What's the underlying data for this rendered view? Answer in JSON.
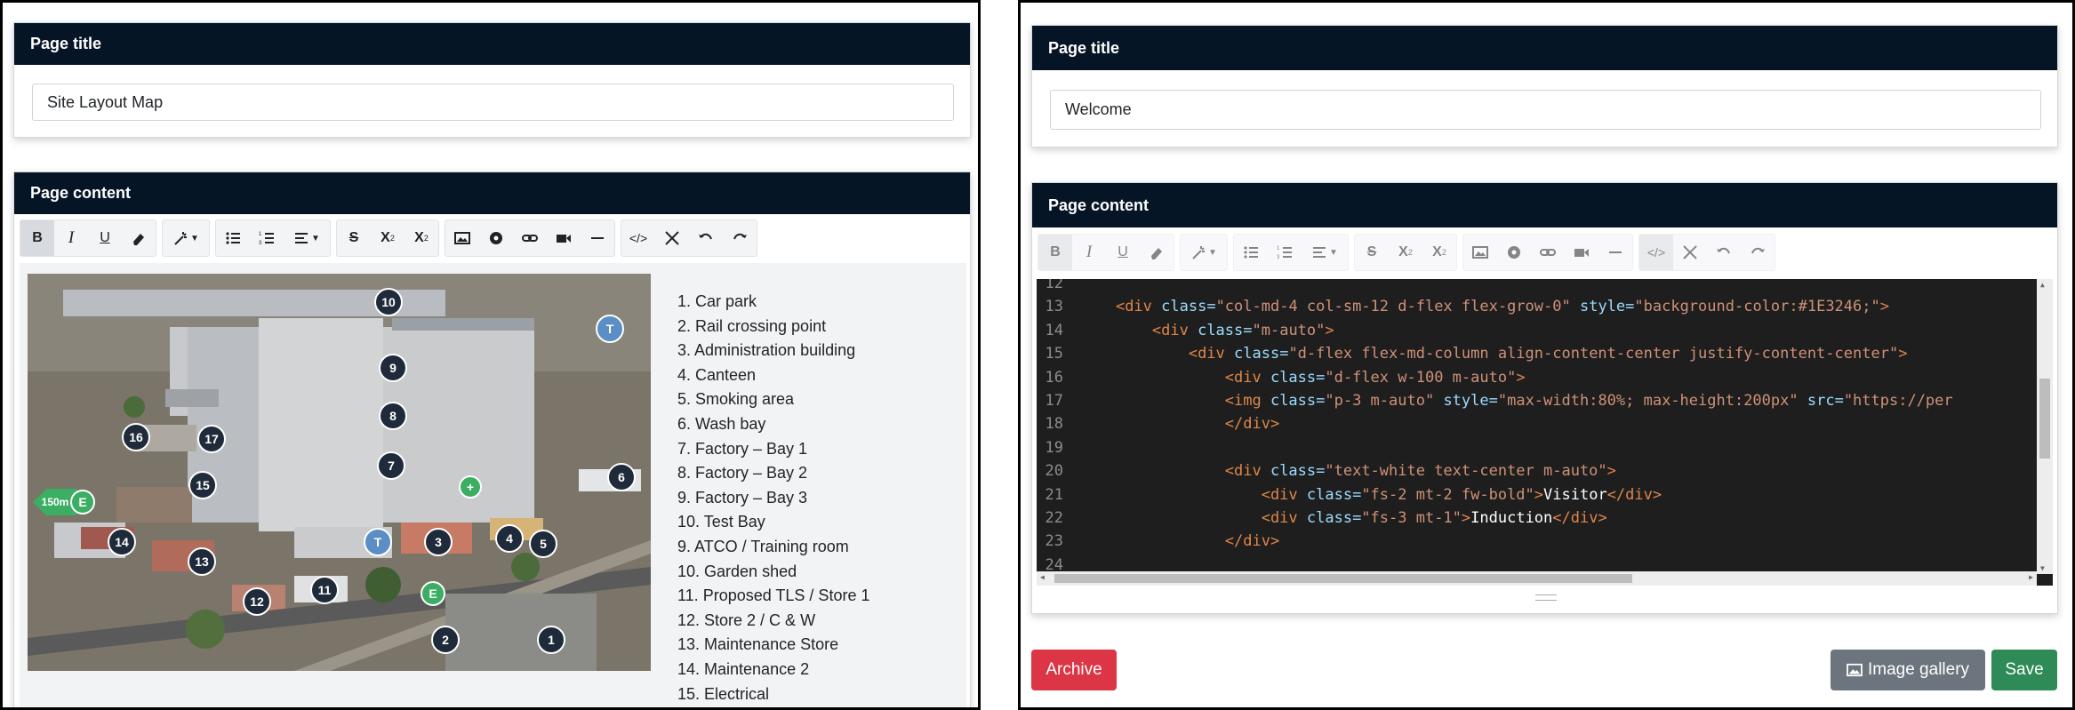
{
  "left_panel": {
    "title_card": {
      "header": "Page title",
      "value": "Site Layout Map"
    },
    "content_card": {
      "header": "Page content",
      "map": {
        "distance_badge": "150m",
        "exit_label": "E"
      },
      "legend": [
        "1. Car park",
        "2. Rail crossing point",
        "3. Administration building",
        "4. Canteen",
        "5. Smoking area",
        "6. Wash bay",
        "7. Factory – Bay 1",
        "8. Factory – Bay 2",
        "9. Factory – Bay 3",
        "10. Test Bay",
        "9. ATCO / Training room",
        "10. Garden shed",
        "11. Proposed TLS / Store 1",
        "12. Store 2 / C & W",
        "13. Maintenance Store",
        "14. Maintenance 2",
        "15. Electrical"
      ]
    }
  },
  "right_panel": {
    "title_card": {
      "header": "Page title",
      "value": "Welcome"
    },
    "content_card": {
      "header": "Page content",
      "code_lines": [
        {
          "n": "12",
          "indent": "",
          "parts": []
        },
        {
          "n": "13",
          "indent": "    ",
          "parts": [
            [
              "tag",
              "<div "
            ],
            [
              "att",
              "class="
            ],
            [
              "str",
              "\"col-md-4 col-sm-12 d-flex flex-grow-0\""
            ],
            [
              "att",
              " style="
            ],
            [
              "str",
              "\"background-color:#1E3246;\""
            ],
            [
              "tag",
              ">"
            ]
          ]
        },
        {
          "n": "14",
          "indent": "        ",
          "parts": [
            [
              "tag",
              "<div "
            ],
            [
              "att",
              "class="
            ],
            [
              "str",
              "\"m-auto\""
            ],
            [
              "tag",
              ">"
            ]
          ]
        },
        {
          "n": "15",
          "indent": "            ",
          "parts": [
            [
              "tag",
              "<div "
            ],
            [
              "att",
              "class="
            ],
            [
              "str",
              "\"d-flex flex-md-column align-content-center justify-content-center\""
            ],
            [
              "tag",
              ">"
            ]
          ]
        },
        {
          "n": "16",
          "indent": "                ",
          "parts": [
            [
              "tag",
              "<div "
            ],
            [
              "att",
              "class="
            ],
            [
              "str",
              "\"d-flex w-100 m-auto\""
            ],
            [
              "tag",
              ">"
            ]
          ]
        },
        {
          "n": "17",
          "indent": "                ",
          "parts": [
            [
              "tag",
              "<img "
            ],
            [
              "att",
              "class="
            ],
            [
              "str",
              "\"p-3 m-auto\""
            ],
            [
              "att",
              " style="
            ],
            [
              "str",
              "\"max-width:80%; max-height:200px\""
            ],
            [
              "att",
              " src="
            ],
            [
              "str",
              "\"https://per"
            ]
          ]
        },
        {
          "n": "18",
          "indent": "                ",
          "parts": [
            [
              "tag",
              "</div>"
            ]
          ]
        },
        {
          "n": "19",
          "indent": "",
          "parts": []
        },
        {
          "n": "20",
          "indent": "                ",
          "parts": [
            [
              "tag",
              "<div "
            ],
            [
              "att",
              "class="
            ],
            [
              "str",
              "\"text-white text-center m-auto\""
            ],
            [
              "tag",
              ">"
            ]
          ]
        },
        {
          "n": "21",
          "indent": "                    ",
          "parts": [
            [
              "tag",
              "<div "
            ],
            [
              "att",
              "class="
            ],
            [
              "str",
              "\"fs-2 mt-2 fw-bold\""
            ],
            [
              "tag",
              ">"
            ],
            [
              "txt",
              "Visitor"
            ],
            [
              "tag",
              "</div>"
            ]
          ]
        },
        {
          "n": "22",
          "indent": "                    ",
          "parts": [
            [
              "tag",
              "<div "
            ],
            [
              "att",
              "class="
            ],
            [
              "str",
              "\"fs-3 mt-1\""
            ],
            [
              "tag",
              ">"
            ],
            [
              "txt",
              "Induction"
            ],
            [
              "tag",
              "</div>"
            ]
          ]
        },
        {
          "n": "23",
          "indent": "                ",
          "parts": [
            [
              "tag",
              "</div>"
            ]
          ]
        },
        {
          "n": "24",
          "indent": "",
          "parts": []
        }
      ]
    },
    "buttons": {
      "archive": "Archive",
      "gallery": "Image gallery",
      "save": "Save"
    }
  },
  "colors": {
    "header_bg": "#061526",
    "archive": "#dc3545",
    "gallery": "#6c757d",
    "save": "#2e8b57"
  },
  "toolbar_icons": [
    "bold-icon",
    "italic-icon",
    "underline-icon",
    "eraser-icon",
    "magic-wand-icon",
    "bullet-list-icon",
    "number-list-icon",
    "align-icon",
    "strikethrough-icon",
    "superscript-icon",
    "subscript-icon",
    "image-icon",
    "circle-plus-icon",
    "link-icon",
    "video-icon",
    "horizontal-rule-icon",
    "code-view-icon",
    "fullscreen-icon",
    "undo-icon",
    "redo-icon"
  ]
}
